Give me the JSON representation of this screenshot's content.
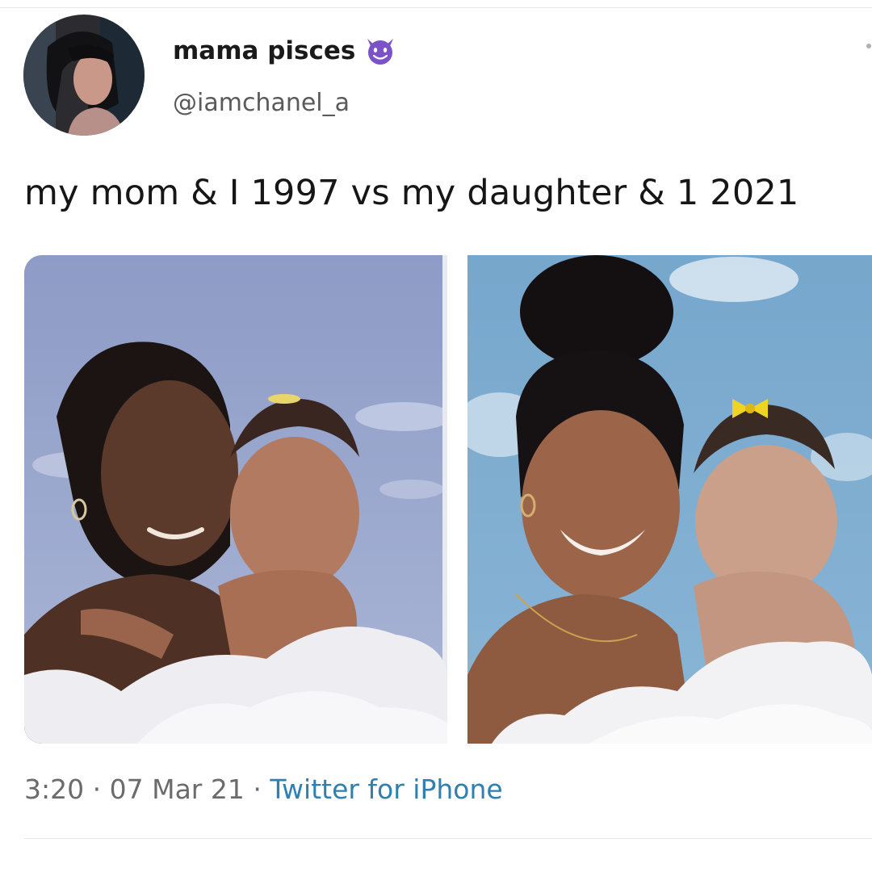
{
  "tweet": {
    "display_name": "mama pisces",
    "name_emoji": "smiling-imp-emoji",
    "handle": "@iamchanel_a",
    "text": "my mom & I 1997 vs my daughter & 1 2021",
    "time": "3:20",
    "separator": "·",
    "date": "07 Mar 21",
    "source": "Twitter for iPhone"
  },
  "media": [
    {
      "name": "photo-1997"
    },
    {
      "name": "photo-2021"
    }
  ],
  "colors": {
    "link": "#2f7fb0",
    "emoji": "#7b52c8",
    "text": "#161616",
    "muted": "#6b6b6b"
  }
}
